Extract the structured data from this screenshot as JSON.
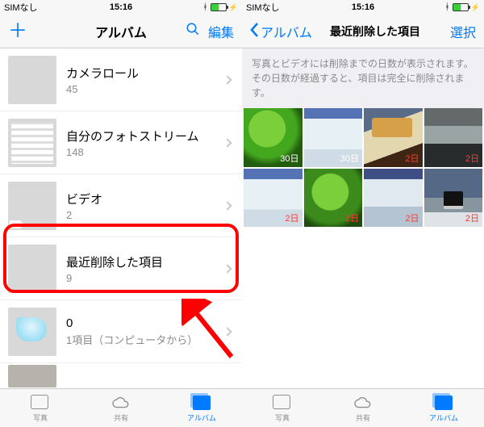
{
  "status": {
    "carrier": "SIMなし",
    "time": "15:16"
  },
  "left": {
    "nav": {
      "title": "アルバム",
      "edit": "編集"
    },
    "albums": [
      {
        "name": "カメラロール",
        "count": "45"
      },
      {
        "name": "自分のフォトストリーム",
        "count": "148"
      },
      {
        "name": "ビデオ",
        "count": "2"
      },
      {
        "name": "最近削除した項目",
        "count": "9"
      },
      {
        "name": "0",
        "count": "1項目（コンピュータから）"
      }
    ]
  },
  "right": {
    "nav": {
      "back": "アルバム",
      "title": "最近削除した項目",
      "select": "選択"
    },
    "info": "写真とビデオには削除までの日数が表示されます。その日数が経過すると、項目は完全に削除されます。",
    "items": [
      {
        "days": "30日",
        "red": false
      },
      {
        "days": "30日",
        "red": false
      },
      {
        "days": "2日",
        "red": true
      },
      {
        "days": "2日",
        "red": true
      },
      {
        "days": "2日",
        "red": true
      },
      {
        "days": "2日",
        "red": true
      },
      {
        "days": "2日",
        "red": true
      },
      {
        "days": "2日",
        "red": true
      }
    ]
  },
  "tabs": {
    "photos": "写真",
    "shared": "共有",
    "albums": "アルバム"
  }
}
